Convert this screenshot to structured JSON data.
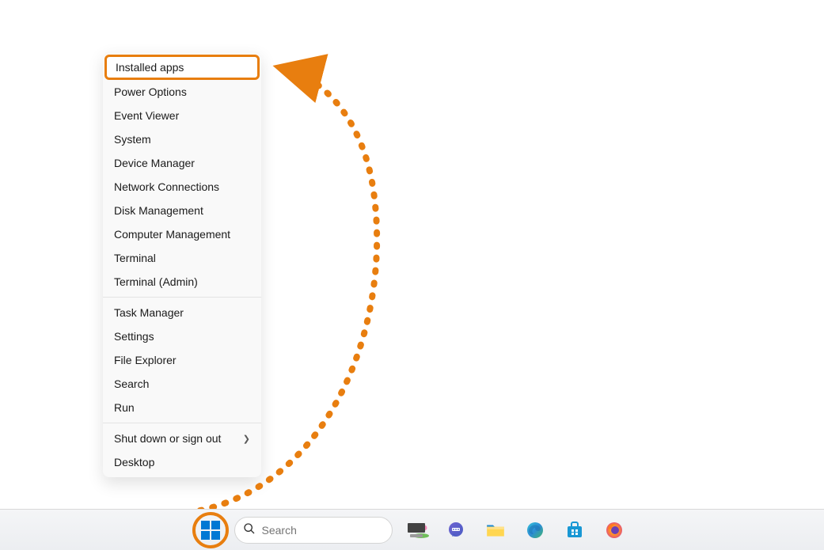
{
  "context_menu": {
    "groups": [
      [
        {
          "label": "Installed apps",
          "highlighted": true
        },
        {
          "label": "Power Options"
        },
        {
          "label": "Event Viewer"
        },
        {
          "label": "System"
        },
        {
          "label": "Device Manager"
        },
        {
          "label": "Network Connections"
        },
        {
          "label": "Disk Management"
        },
        {
          "label": "Computer Management"
        },
        {
          "label": "Terminal"
        },
        {
          "label": "Terminal (Admin)"
        }
      ],
      [
        {
          "label": "Task Manager"
        },
        {
          "label": "Settings"
        },
        {
          "label": "File Explorer"
        },
        {
          "label": "Search"
        },
        {
          "label": "Run"
        }
      ],
      [
        {
          "label": "Shut down or sign out",
          "submenu": true
        },
        {
          "label": "Desktop"
        }
      ]
    ]
  },
  "taskbar": {
    "search_placeholder": "Search"
  },
  "annotation": {
    "color": "#e87e0f"
  }
}
